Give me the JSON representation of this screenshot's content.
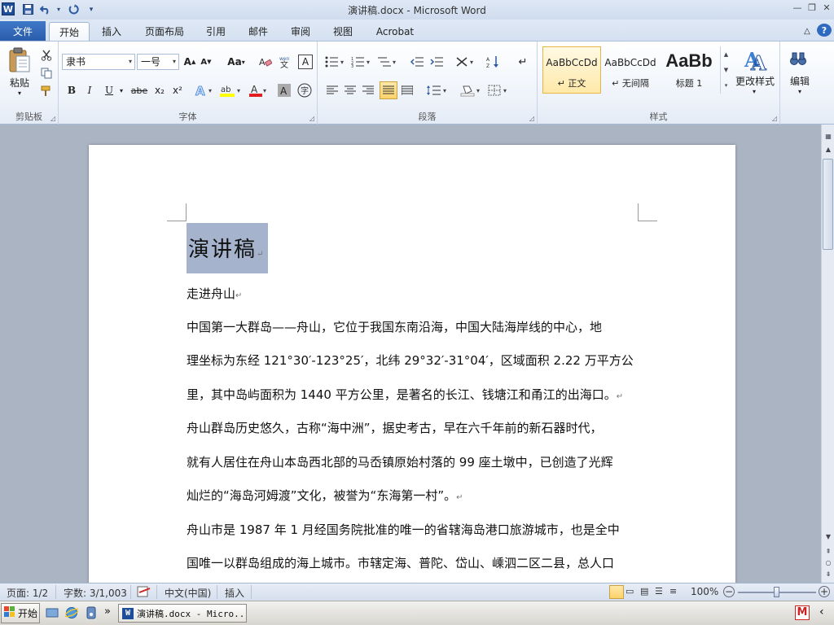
{
  "window": {
    "title": "演讲稿.docx  -  Microsoft Word",
    "quick_access": {
      "app_icon": "word-app-icon",
      "save": "save-icon",
      "undo": "undo-icon",
      "redo": "redo-icon",
      "customize": "▾"
    },
    "controls": {
      "minimize": "—",
      "restore": "❐",
      "close": "✕"
    }
  },
  "ribbon_tabs": [
    {
      "label": "文件"
    },
    {
      "label": "开始"
    },
    {
      "label": "插入"
    },
    {
      "label": "页面布局"
    },
    {
      "label": "引用"
    },
    {
      "label": "邮件"
    },
    {
      "label": "审阅"
    },
    {
      "label": "视图"
    },
    {
      "label": "Acrobat"
    }
  ],
  "ribbon_right": {
    "collapse": "△",
    "help": "?"
  },
  "groups": {
    "clipboard": {
      "label": "剪贴板",
      "paste": "粘贴"
    },
    "font": {
      "label": "字体",
      "font_name": "隶书",
      "font_size": "一号",
      "grow": "A",
      "shrink": "A",
      "change_case": "Aa",
      "bold": "B",
      "italic": "I",
      "underline": "U",
      "strike": "abe",
      "subscript": "x₂",
      "superscript": "x²"
    },
    "paragraph": {
      "label": "段落"
    },
    "styles": {
      "label": "样式",
      "items": [
        {
          "preview": "AaBbCcDd",
          "name": "↵ 正文"
        },
        {
          "preview": "AaBbCcDd",
          "name": "↵ 无间隔"
        },
        {
          "preview": "AaBb",
          "name": "标题 1"
        }
      ],
      "change_styles": "更改样式"
    },
    "editing": {
      "label": "编辑"
    }
  },
  "document": {
    "title": "演讲稿",
    "paragraphs": [
      "走进舟山",
      "中国第一大群岛——舟山，它位于我国东南沿海，中国大陆海岸线的中心，地",
      "理坐标为东经 121°30′-123°25′，北纬 29°32′-31°04′，区域面积 2.22 万平方公",
      "里，其中岛屿面积为 1440 平方公里，是著名的长江、钱塘江和甬江的出海口。",
      "舟山群岛历史悠久，古称“海中洲”，据史考古，早在六千年前的新石器时代，",
      "就有人居住在舟山本岛西北部的马岙镇原始村落的 99 座土墩中，已创造了光辉",
      "灿烂的“海岛河姆渡”文化，被誉为“东海第一村”。",
      "舟山市是 1987 年 1 月经国务院批准的唯一的省辖海岛港口旅游城市，也是全中",
      "国唯一以群岛组成的海上城市。市辖定海、普陀、岱山、嵊泗二区二县，总人口"
    ],
    "paragraph_mark": "↵"
  },
  "status_bar": {
    "page": "页面: 1/2",
    "words": "字数: 3/1,003",
    "language": "中文(中国)",
    "mode": "插入",
    "zoom": "100%",
    "zoom_level_fraction": 0.5
  },
  "taskbar": {
    "start": "开始",
    "task_button": "演讲稿.docx - Micro...",
    "chevron": "»",
    "tray_label": "M",
    "tray_arrow": "‹"
  }
}
